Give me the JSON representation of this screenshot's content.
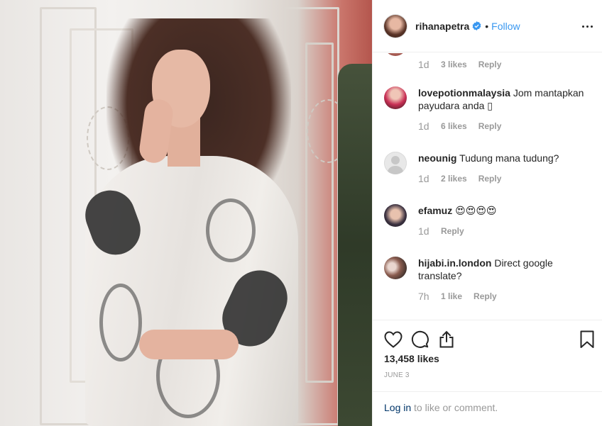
{
  "post": {
    "author": "rihanapetra",
    "verified": true,
    "separator": "•",
    "follow_label": "Follow"
  },
  "comments": {
    "first_partial": {
      "time": "1d",
      "likes": "3 likes",
      "reply": "Reply"
    },
    "items": [
      {
        "username": "lovepotionmalaysia",
        "text": "Jom mantapkan payudara anda ▯",
        "time": "1d",
        "likes": "6 likes",
        "reply": "Reply"
      },
      {
        "username": "neounig",
        "text": "Tudung mana tudung?",
        "time": "1d",
        "likes": "2 likes",
        "reply": "Reply"
      },
      {
        "username": "efamuz",
        "text": "😍😍😍😍",
        "time": "1d",
        "likes": "",
        "reply": "Reply"
      },
      {
        "username": "hijabi.in.london",
        "text": "Direct google translate?",
        "time": "7h",
        "likes": "1 like",
        "reply": "Reply"
      }
    ]
  },
  "actions": {
    "like_count": "13,458 likes",
    "date": "JUNE 3",
    "icons": [
      "heart-icon",
      "comment-icon",
      "share-icon",
      "bookmark-icon"
    ]
  },
  "login": {
    "link_label": "Log in",
    "suffix": " to like or comment."
  },
  "colors": {
    "link_blue": "#3897f0",
    "text_dark": "#262626",
    "text_muted": "#999999",
    "login_link": "#003569"
  }
}
